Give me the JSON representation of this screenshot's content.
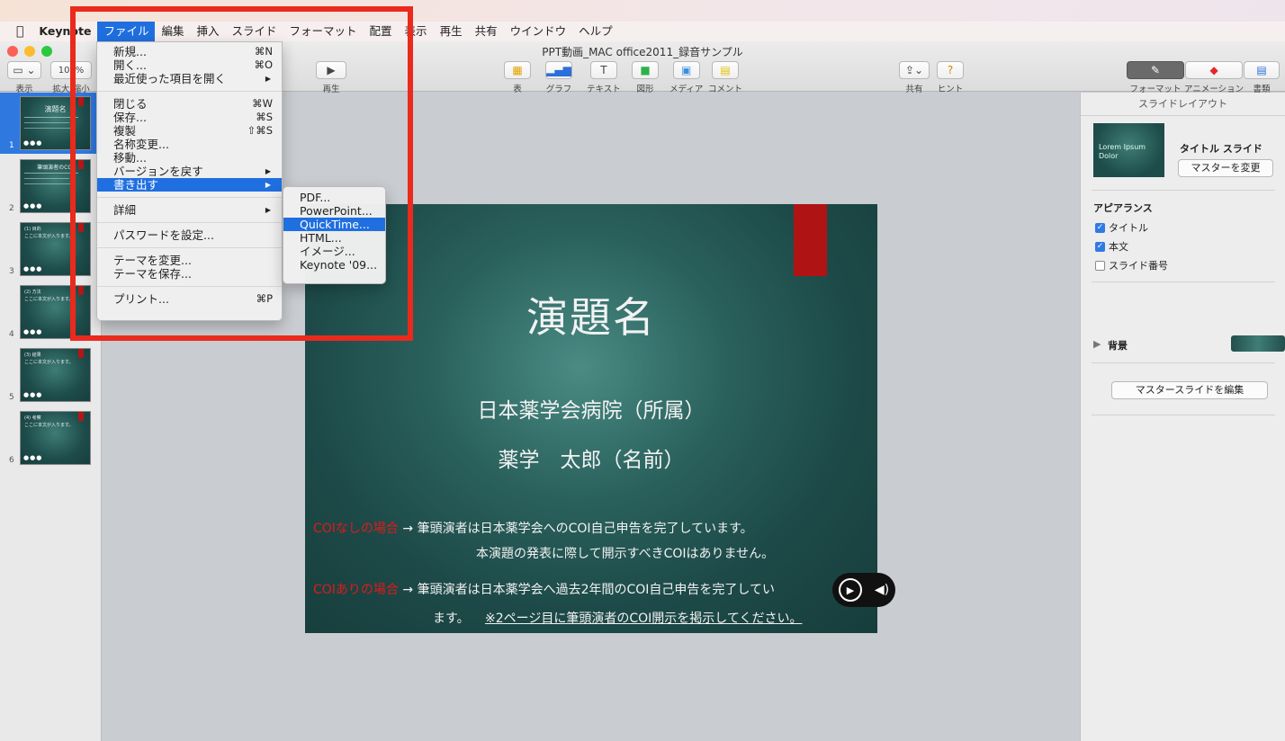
{
  "menubar": {
    "apple": "",
    "app_name": "Keynote",
    "items": [
      "ファイル",
      "編集",
      "挿入",
      "スライド",
      "フォーマット",
      "配置",
      "表示",
      "再生",
      "共有",
      "ウインドウ",
      "ヘルプ"
    ]
  },
  "window": {
    "title": "PPT動画_MAC office2011_録音サンプル"
  },
  "toolbar": {
    "view": "表示",
    "zoom_value": "100%",
    "zoom": "拡大/縮小",
    "play": "再生",
    "table": "表",
    "chart": "グラフ",
    "text": "テキスト",
    "shape": "図形",
    "media": "メディア",
    "comment": "コメント",
    "share": "共有",
    "tips": "ヒント",
    "format": "フォーマット",
    "animate": "アニメーション",
    "document": "書類"
  },
  "file_menu": {
    "items": [
      {
        "label": "新規...",
        "shortcut": "⌘N"
      },
      {
        "label": "開く...",
        "shortcut": "⌘O"
      },
      {
        "label": "最近使った項目を開く",
        "shortcut": "▶"
      },
      {
        "label": "閉じる",
        "shortcut": "⌘W"
      },
      {
        "label": "保存...",
        "shortcut": "⌘S"
      },
      {
        "label": "複製",
        "shortcut": "⇧⌘S"
      },
      {
        "label": "名称変更...",
        "shortcut": ""
      },
      {
        "label": "移動...",
        "shortcut": ""
      },
      {
        "label": "バージョンを戻す",
        "shortcut": "▶"
      },
      {
        "label": "書き出す",
        "shortcut": "▶"
      },
      {
        "label": "詳細",
        "shortcut": "▶"
      },
      {
        "label": "パスワードを設定...",
        "shortcut": ""
      },
      {
        "label": "テーマを変更...",
        "shortcut": ""
      },
      {
        "label": "テーマを保存...",
        "shortcut": ""
      },
      {
        "label": "プリント...",
        "shortcut": "⌘P"
      }
    ]
  },
  "export_menu": {
    "items": [
      "PDF...",
      "PowerPoint...",
      "QuickTime...",
      "HTML...",
      "イメージ...",
      "Keynote '09..."
    ]
  },
  "navigator": {
    "slides": [
      {
        "num": "1",
        "title": "演題名"
      },
      {
        "num": "2",
        "title": "筆頭演者のCOI"
      },
      {
        "num": "3",
        "title": "(1) 目的"
      },
      {
        "num": "4",
        "title": "(2) 方法"
      },
      {
        "num": "5",
        "title": "(3) 結果"
      },
      {
        "num": "6",
        "title": "(4) 考察"
      }
    ],
    "thumb_body": "ここに本文が入ります。",
    "dots": "●●●"
  },
  "slide": {
    "title": "演題名",
    "affiliation": "日本薬学会病院（所属）",
    "name": "薬学　太郎（名前）",
    "coi_none_label": "COIなしの場合",
    "coi_none_text": " → 筆頭演者は日本薬学会へのCOI自己申告を完了しています。",
    "coi_none_text2": "本演題の発表に際して開示すべきCOIはありません。",
    "coi_yes_label": "COIありの場合",
    "coi_yes_text": " → 筆頭演者は日本薬学会へ過去2年間のCOI自己申告を完了してい",
    "coi_yes_text2": "ます。",
    "coi_yes_note": "※2ページ目に筆頭演者のCOI開示を掲示してください。"
  },
  "inspector": {
    "header": "スライドレイアウト",
    "layout_thumb_text": "Lorem Ipsum Dolor",
    "layout_name": "タイトル スライド",
    "change_master": "マスターを変更",
    "appearance": "アピアランス",
    "chk_title": "タイトル",
    "chk_body": "本文",
    "chk_slide_number": "スライド番号",
    "background": "背景",
    "edit_master": "マスタースライドを編集"
  },
  "colors": {
    "menu_highlight": "#1f6fe0",
    "annotation_box": "#ea2a1c",
    "slide_red_tab": "#b01313"
  }
}
